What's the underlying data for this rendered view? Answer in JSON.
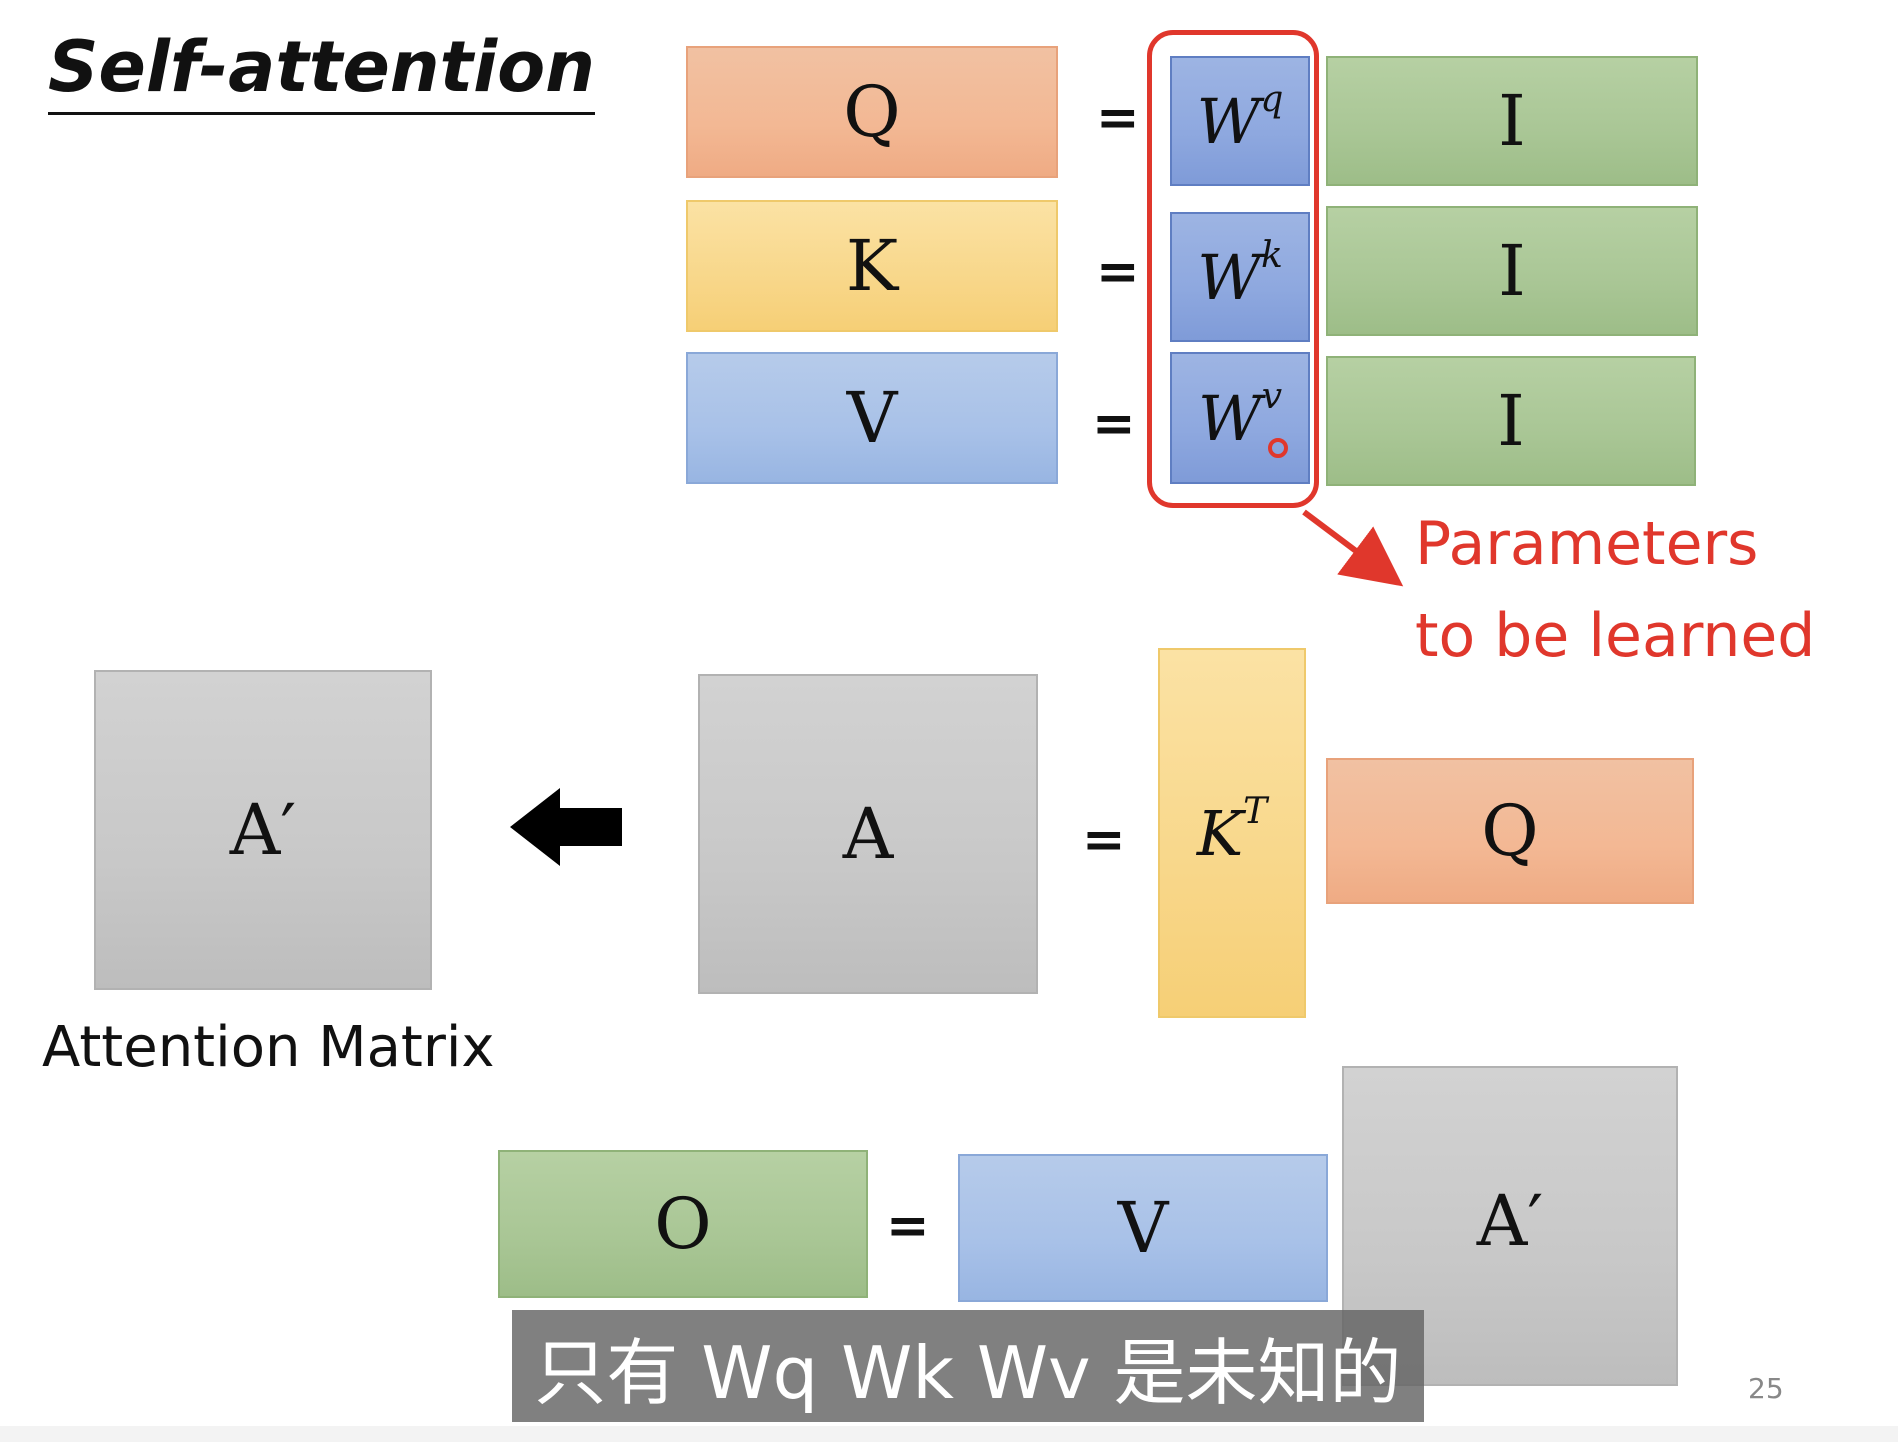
{
  "slide": {
    "title": "Self-attention",
    "page_number": "25",
    "subtitle": "只有 Wq Wk Wv 是未知的"
  },
  "colors": {
    "query": "#f3b894",
    "key": "#f8d78a",
    "value": "#a8c1e8",
    "input": "#a9c695",
    "weights": "#8ea8df",
    "matrix": "#c8c8c8",
    "highlight": "#e0372c"
  },
  "row_q": {
    "lhs": "Q",
    "equals": "=",
    "w_base": "W",
    "w_sup": "q",
    "rhs": "I"
  },
  "row_k": {
    "lhs": "K",
    "equals": "=",
    "w_base": "W",
    "w_sup": "k",
    "rhs": "I"
  },
  "row_v": {
    "lhs": "V",
    "equals": "=",
    "w_base": "W",
    "w_sup": "v",
    "rhs": "I"
  },
  "annotation": {
    "line1": "Parameters",
    "line2": "to be learned"
  },
  "attention": {
    "normalized": "A′",
    "caption": "Attention Matrix",
    "arrow_icon": "arrow-left-icon",
    "raw": "A",
    "equals": "=",
    "kt_base": "K",
    "kt_sup": "T",
    "q": "Q"
  },
  "output": {
    "o": "O",
    "equals": "=",
    "v": "V",
    "a_prime": "A′"
  }
}
